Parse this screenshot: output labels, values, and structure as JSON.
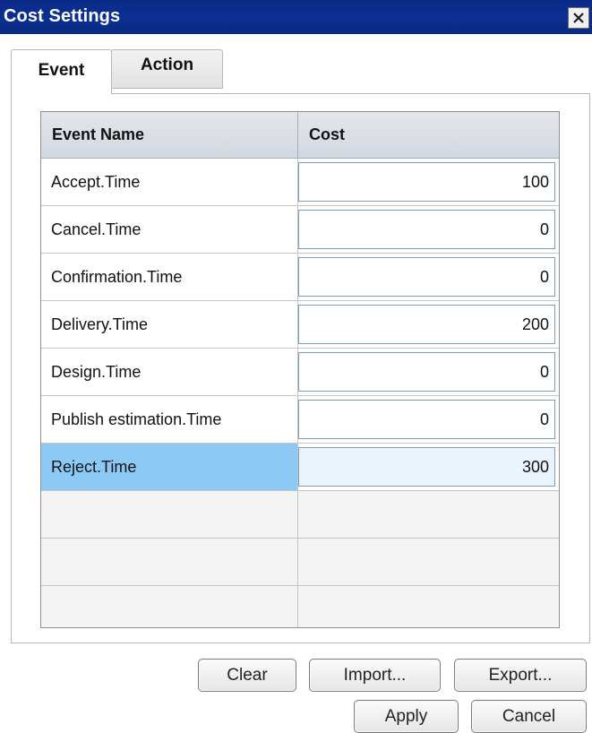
{
  "window": {
    "title": "Cost Settings",
    "close_icon": "close-icon"
  },
  "tabs": [
    {
      "label": "Event",
      "active": true
    },
    {
      "label": "Action",
      "active": false
    }
  ],
  "table": {
    "columns": [
      "Event Name",
      "Cost"
    ],
    "rows": [
      {
        "name": "Accept.Time",
        "cost": "100"
      },
      {
        "name": "Cancel.Time",
        "cost": "0"
      },
      {
        "name": "Confirmation.Time",
        "cost": "0"
      },
      {
        "name": "Delivery.Time",
        "cost": "200"
      },
      {
        "name": "Design.Time",
        "cost": "0"
      },
      {
        "name": "Publish estimation.Time",
        "cost": "0"
      },
      {
        "name": "Reject.Time",
        "cost": "300"
      }
    ],
    "selected_row": 6
  },
  "buttons": {
    "clear": "Clear",
    "import": "Import...",
    "export": "Export...",
    "apply": "Apply",
    "cancel": "Cancel"
  },
  "colors": {
    "titlebar": "#0b2f93",
    "selection": "#8cc9f5",
    "header_bg": "#d9dde5"
  }
}
